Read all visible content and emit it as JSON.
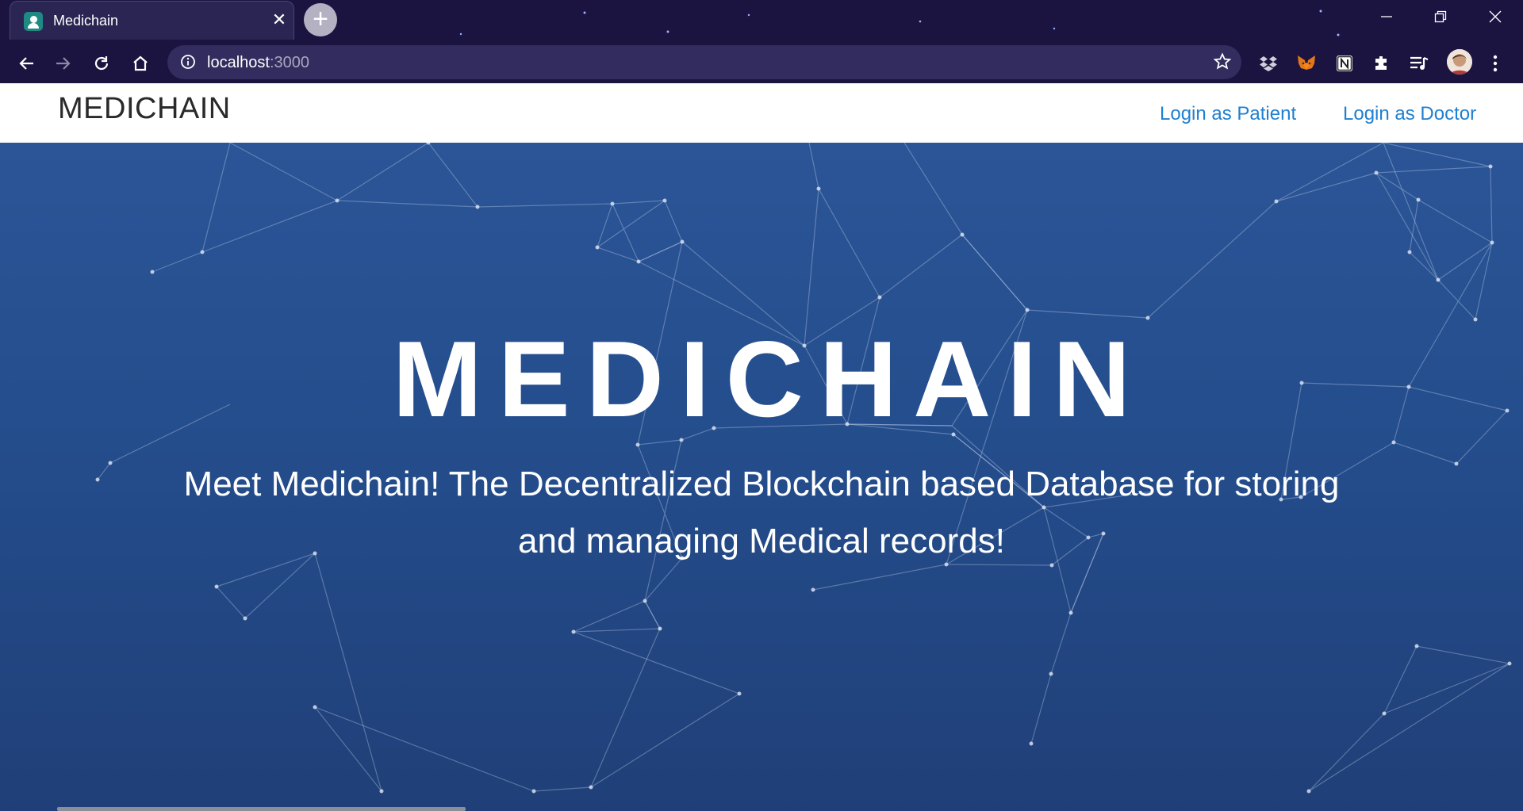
{
  "browser": {
    "tab": {
      "title": "Medichain",
      "favicon": "medichain-favicon"
    },
    "url_host": "localhost",
    "url_port": ":3000",
    "icons": [
      "back-icon",
      "forward-icon",
      "reload-icon",
      "home-icon",
      "site-info-icon",
      "bookmark-star-icon",
      "dropbox-icon",
      "metamask-icon",
      "notion-icon",
      "extensions-icon",
      "media-queue-icon",
      "profile-avatar",
      "menu-icon"
    ],
    "window_controls": [
      "minimize-icon",
      "restore-icon",
      "close-icon"
    ]
  },
  "navbar": {
    "brand": "MEDICHAIN",
    "links": [
      "Login as Patient",
      "Login as Doctor"
    ],
    "link_color": "#1f7fd1"
  },
  "hero": {
    "title": "MEDICHAIN",
    "subtitle": "Meet Medichain! The Decentralized Blockchain based Database for storing and managing Medical records!",
    "background_color": "#2b5597"
  }
}
